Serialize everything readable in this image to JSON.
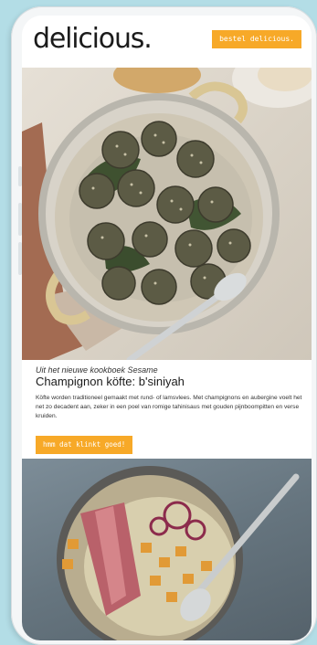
{
  "header": {
    "logo_text": "delicious.",
    "order_button_label": "bestel delicious."
  },
  "article": {
    "kicker": "Uit het nieuwe kookboek Sesame",
    "title": "Champignon köfte: b'siniyah",
    "description": "Köfte worden traditioneel gemaakt met rund- of lamsvlees. Met champignons en aubergine voelt het net zo decadent aan, zeker in een poel van romige tahinisaus met gouden pijnboompitten en verse kruiden.",
    "cta_label": "hmm dat klinkt goed!"
  },
  "colors": {
    "background": "#b3dde6",
    "accent": "#f7a928",
    "text": "#1b1b1b"
  }
}
